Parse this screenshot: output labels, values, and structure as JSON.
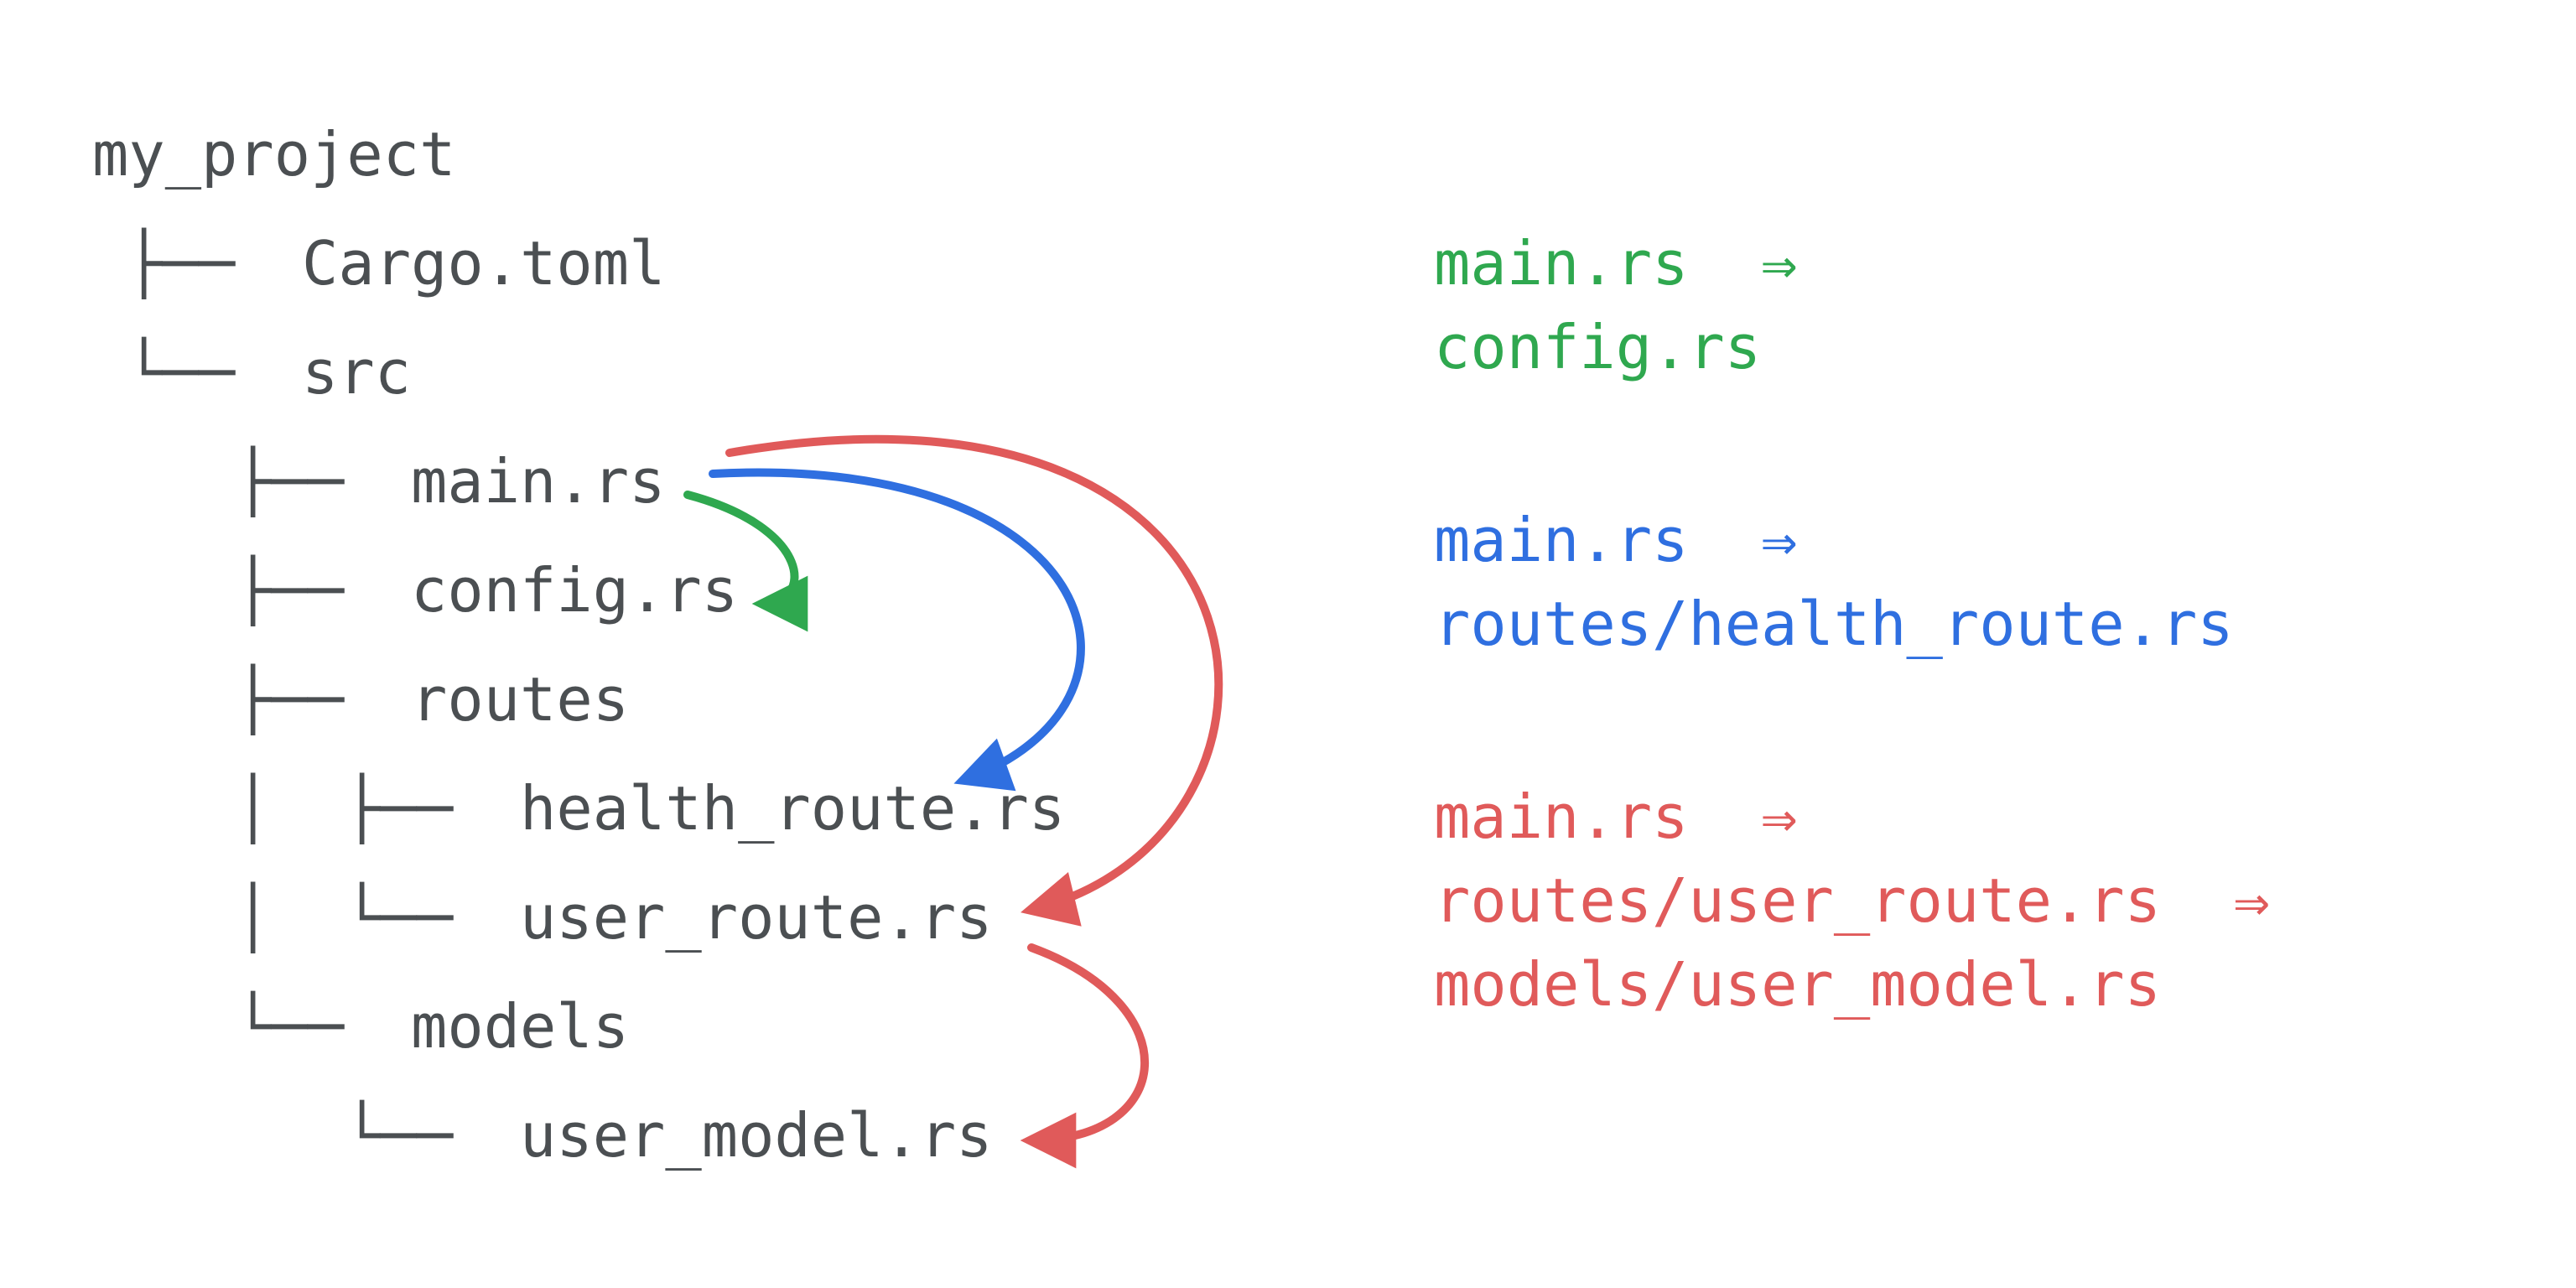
{
  "colors": {
    "text": "#4b4f52",
    "green": "#2fa84f",
    "blue": "#2f6fe0",
    "red": "#e05a5a"
  },
  "tree": {
    "root": "my_project",
    "cargo": "Cargo.toml",
    "src": "src",
    "main": "main.rs",
    "config": "config.rs",
    "routes": "routes",
    "health": "health_route.rs",
    "userRoute": "user_route.rs",
    "models": "models",
    "userModel": "user_model.rs"
  },
  "legend": {
    "green": {
      "l1": "main.rs  ⇒",
      "l2": "config.rs"
    },
    "blue": {
      "l1": "main.rs  ⇒",
      "l2": "routes/health_route.rs"
    },
    "red": {
      "l1": "main.rs  ⇒",
      "l2": "routes/user_route.rs  ⇒",
      "l3": "models/user_model.rs"
    }
  },
  "arrows": {
    "green": {
      "from": "main.rs",
      "to": "config.rs"
    },
    "blue": {
      "from": "main.rs",
      "to": "routes/health_route.rs"
    },
    "red1": {
      "from": "main.rs",
      "to": "routes/user_route.rs"
    },
    "red2": {
      "from": "routes/user_route.rs",
      "to": "models/user_model.rs"
    }
  }
}
